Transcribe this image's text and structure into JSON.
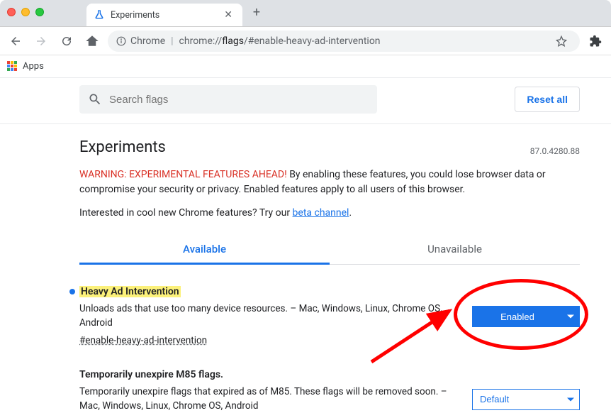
{
  "window": {
    "tab_title": "Experiments"
  },
  "toolbar": {
    "secure_label": "Chrome",
    "url_scheme": "chrome://",
    "url_host": "flags",
    "url_path": "/#enable-heavy-ad-intervention"
  },
  "bookmarks": {
    "apps_label": "Apps"
  },
  "search": {
    "placeholder": "Search flags"
  },
  "buttons": {
    "reset_all": "Reset all"
  },
  "page": {
    "title": "Experiments",
    "version": "87.0.4280.88",
    "warning_prefix": "WARNING: EXPERIMENTAL FEATURES AHEAD!",
    "warning_body": " By enabling these features, you could lose browser data or compromise your security or privacy. Enabled features apply to all users of this browser.",
    "interest_prefix": "Interested in cool new Chrome features? Try our ",
    "interest_link": "beta channel",
    "interest_suffix": "."
  },
  "tabs": {
    "available": "Available",
    "unavailable": "Unavailable"
  },
  "flags": [
    {
      "title": "Heavy Ad Intervention",
      "desc": "Unloads ads that use too many device resources. – Mac, Windows, Linux, Chrome OS, Android",
      "hash": "#enable-heavy-ad-intervention",
      "value": "Enabled",
      "highlighted": true,
      "modified": true
    },
    {
      "title": "Temporarily unexpire M85 flags.",
      "desc": "Temporarily unexpire flags that expired as of M85. These flags will be removed soon. – Mac, Windows, Linux, Chrome OS, Android",
      "hash": "",
      "value": "Default",
      "highlighted": false,
      "modified": false
    }
  ]
}
